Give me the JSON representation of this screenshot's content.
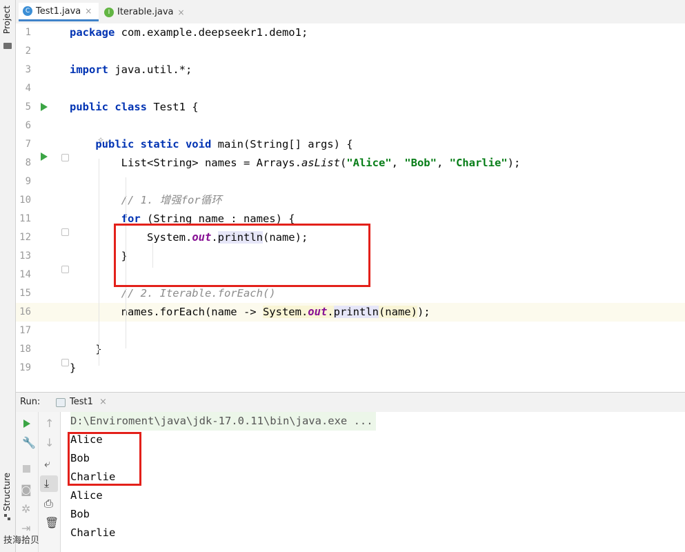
{
  "sidebar": {
    "project_label": "Project",
    "structure_label": "Structure"
  },
  "tabs": [
    {
      "label": "Test1.java",
      "icon_letter": "C",
      "icon_color": "#3c8fd6",
      "active": true
    },
    {
      "label": "Iterable.java",
      "icon_letter": "I",
      "icon_color": "#62b543",
      "active": false
    }
  ],
  "tab_close": "×",
  "editor": {
    "current_line": 16,
    "lines": [
      {
        "num": "1",
        "html": "<span class='kw'>package</span> com.example.deepseekr1.demo1;"
      },
      {
        "num": "2",
        "html": ""
      },
      {
        "num": "3",
        "html": "<span class='kw'>import</span> java.util.*;"
      },
      {
        "num": "4",
        "html": ""
      },
      {
        "num": "5",
        "html": "<span class='kw'>public class</span> Test1 {"
      },
      {
        "num": "6",
        "html": ""
      },
      {
        "num": "7",
        "html": "    <span class='kw'>public static void</span> main(String[] args) {"
      },
      {
        "num": "8",
        "html": "        List&lt;String&gt; names = Arrays.<span class='st'>asList</span>(<span class='str'>\"Alice\"</span>, <span class='str'>\"Bob\"</span>, <span class='str'>\"Charlie\"</span>);"
      },
      {
        "num": "9",
        "html": ""
      },
      {
        "num": "10",
        "html": "        <span class='cmt'>// 1. 增强for循环</span>"
      },
      {
        "num": "11",
        "html": "        <span class='kw'>for</span> (String name : names) {"
      },
      {
        "num": "12",
        "html": "            System.<span class='fld'>out</span>.<span class='hl'>println</span>(name);"
      },
      {
        "num": "13",
        "html": "        }"
      },
      {
        "num": "14",
        "html": ""
      },
      {
        "num": "15",
        "html": "        <span class='cmt'>// 2. Iterable.forEach()</span>"
      },
      {
        "num": "16",
        "html": "        names.forEach(name -&gt; <span class='hl2'>System.<span class='fld'>out</span>.</span><span class='hl'>println</span><span class='hl2'>(name)</span>);"
      },
      {
        "num": "17",
        "html": ""
      },
      {
        "num": "18",
        "html": "    }"
      },
      {
        "num": "19",
        "html": "}"
      }
    ]
  },
  "run_panel": {
    "label": "Run:",
    "tab_label": "Test1",
    "command": "D:\\Enviroment\\java\\jdk-17.0.11\\bin\\java.exe ...",
    "output": [
      "Alice",
      "Bob",
      "Charlie",
      "Alice",
      "Bob",
      "Charlie"
    ]
  },
  "watermark": "技海拾贝",
  "colors": {
    "accent": "#4083c9",
    "highlight_box": "#e3201a",
    "run_green": "#3ba545"
  }
}
